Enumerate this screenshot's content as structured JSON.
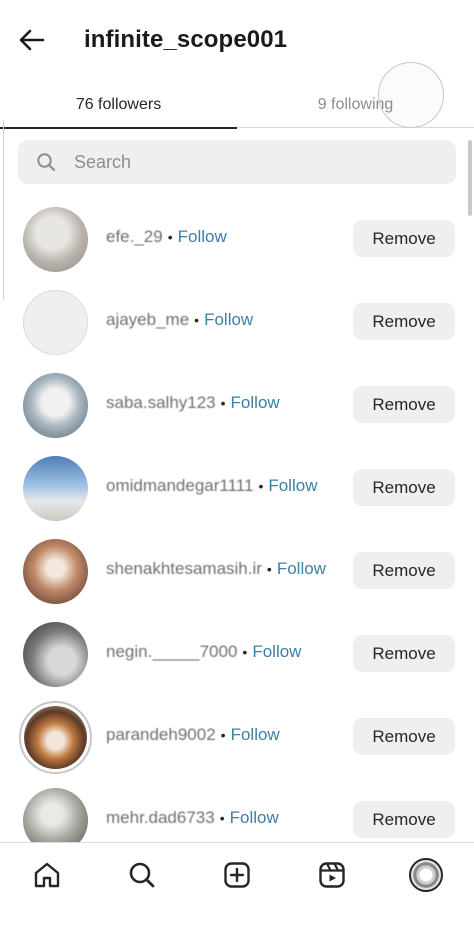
{
  "header": {
    "username": "infinite_scope001",
    "back_icon": "arrow-left-icon"
  },
  "tabs": [
    {
      "label": "76 followers",
      "active": true
    },
    {
      "label": "9 following",
      "active": false
    }
  ],
  "search": {
    "placeholder": "Search",
    "icon": "search-icon"
  },
  "followers": [
    {
      "handle": "efe._29",
      "separator": "•",
      "follow_label": "Follow",
      "remove_label": "Remove",
      "avatar_color": "#bdbab5"
    },
    {
      "handle": "ajayeb_me",
      "separator": "•",
      "follow_label": "Follow",
      "remove_label": "Remove",
      "avatar_color": "#efefef"
    },
    {
      "handle": "saba.salhy123",
      "separator": "•",
      "follow_label": "Follow",
      "remove_label": "Remove",
      "avatar_color": "#7c93a4"
    },
    {
      "handle": "omidmandegar1111",
      "separator": "•",
      "follow_label": "Follow",
      "remove_label": "Remove",
      "avatar_color": "#9fb8d3"
    },
    {
      "handle": "shenakhtesamasih.ir",
      "separator": "•",
      "follow_label": "Follow",
      "remove_label": "Remove",
      "avatar_color": "#8b5a43"
    },
    {
      "handle": "negin._____7000",
      "separator": "•",
      "follow_label": "Follow",
      "remove_label": "Remove",
      "avatar_color": "#6e6e6e"
    },
    {
      "handle": "parandeh9002",
      "separator": "•",
      "follow_label": "Follow",
      "remove_label": "Remove",
      "avatar_color": "#9c6a45"
    },
    {
      "handle": "mehr.dad6733",
      "separator": "•",
      "follow_label": "Follow",
      "remove_label": "Remove",
      "avatar_color": "#8e9088"
    }
  ],
  "bottom_nav": [
    {
      "icon": "home-icon"
    },
    {
      "icon": "search-icon"
    },
    {
      "icon": "create-post-icon"
    },
    {
      "icon": "reels-icon"
    },
    {
      "icon": "profile-avatar"
    }
  ],
  "colors": {
    "follow_link": "#3d7fa6",
    "button_bg": "#efefef",
    "text": "#262626"
  }
}
